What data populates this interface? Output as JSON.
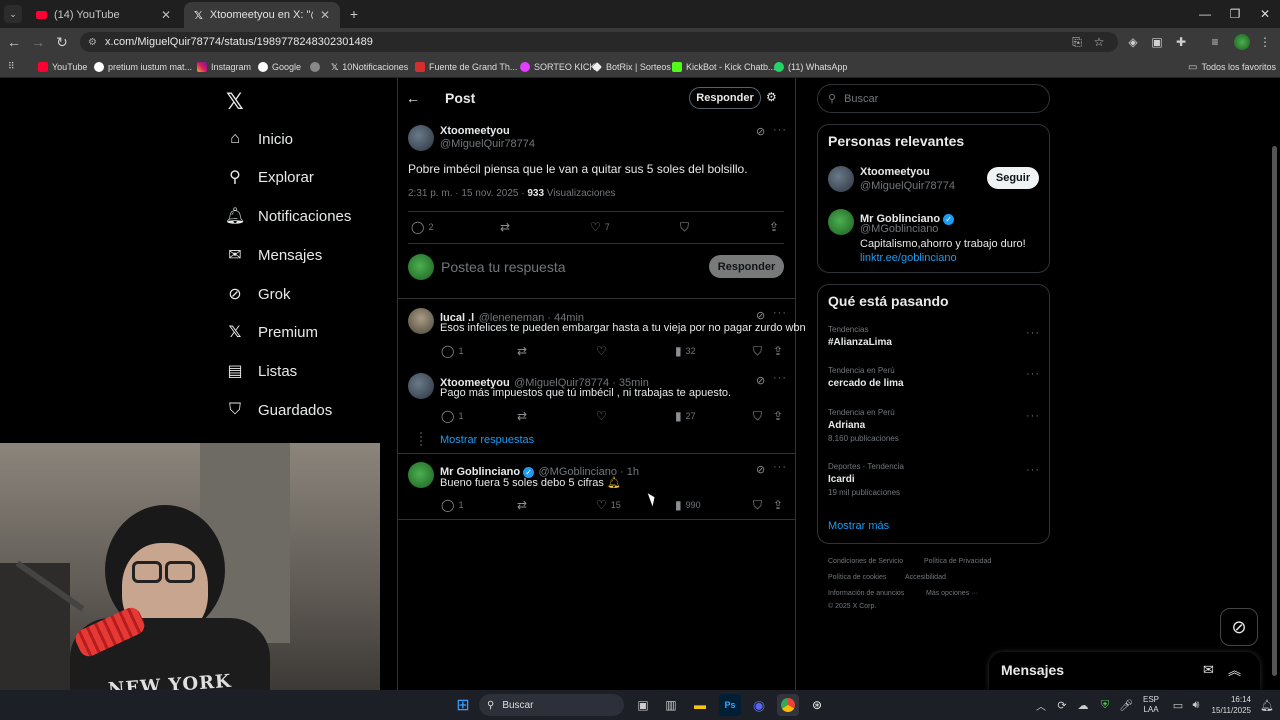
{
  "browser": {
    "tabs": [
      {
        "title": "(14) YouTube",
        "active": false
      },
      {
        "title": "Xtoomeetyou en X: \"@MGoblin",
        "active": true
      }
    ],
    "new_tab": "+",
    "url": "x.com/MiguelQuir78774/status/1989778248302301489",
    "bookmarks": [
      "YouTube",
      "pretium iustum mat...",
      "Instagram",
      "Google",
      "",
      "10Notificaciones",
      "Fuente de Grand Th...",
      "SORTEO KICK",
      "BotRix | Sorteos",
      "KickBot - Kick Chatb...",
      "(11) WhatsApp"
    ],
    "all_bookmarks": "Todos los favoritos"
  },
  "nav": {
    "items": [
      "Inicio",
      "Explorar",
      "Notificaciones",
      "Mensajes",
      "Grok",
      "Premium",
      "Listas",
      "Guardados"
    ]
  },
  "post": {
    "header_title": "Post",
    "reply_btn": "Responder",
    "author_name": "Xtoomeetyou",
    "author_handle": "@MiguelQuir78774",
    "text": "Pobre imbécil piensa que le van a quitar sus 5 soles del bolsillo.",
    "timestamp": "2:31 p. m. · 15 nov. 2025 · ",
    "views": "933",
    "views_label": " Visualizaciones",
    "replies": "2",
    "likes": "7",
    "compose_placeholder": "Postea tu respuesta",
    "compose_btn": "Responder"
  },
  "replies": [
    {
      "name": "lucal .l",
      "handle": "@leneneman · 44min",
      "text": "Esos infelices te pueden embargar hasta a tu vieja por no pagar zurdo wbn",
      "replies": "1",
      "likes": "",
      "views": "32"
    },
    {
      "name": "Xtoomeetyou",
      "handle": "@MiguelQuir78774 · 35min",
      "text": "Pago más impuestos que tú imbécil , ni trabajas te apuesto.",
      "replies": "1",
      "likes": "",
      "views": "27"
    },
    {
      "name": "Mr Goblinciano",
      "handle": "@MGoblinciano · 1h",
      "text": "Bueno fuera 5 soles debo 5 cifras",
      "replies": "1",
      "likes": "15",
      "views": "990"
    }
  ],
  "show_replies": "Mostrar respuestas",
  "search_placeholder": "Buscar",
  "relevant": {
    "title": "Personas relevantes",
    "people": [
      {
        "name": "Xtoomeetyou",
        "handle": "@MiguelQuir78774",
        "btn": "Seguir"
      },
      {
        "name": "Mr Goblinciano",
        "handle": "@MGoblinciano",
        "bio": "Capitalismo,ahorro y trabajo duro!",
        "link": "linktr.ee/goblinciano"
      }
    ]
  },
  "trending": {
    "title": "Qué está pasando",
    "items": [
      {
        "cat": "Tendencias",
        "name": "#AlianzaLima",
        "count": ""
      },
      {
        "cat": "Tendencia en Perú",
        "name": "cercado de lima",
        "count": ""
      },
      {
        "cat": "Tendencia en Perú",
        "name": "Adriana",
        "count": "8.160 publicaciones"
      },
      {
        "cat": "Deportes · Tendencia",
        "name": "Icardi",
        "count": "19 mil publicaciones"
      }
    ],
    "more": "Mostrar más"
  },
  "footer": {
    "links": [
      "Condiciones de Servicio",
      "Política de Privacidad",
      "Política de cookies",
      "Accesibilidad",
      "Información de anuncios",
      "Más opciones ···"
    ],
    "copyright": "© 2025 X Corp."
  },
  "messages_drawer": "Mensajes",
  "taskbar": {
    "search": "Buscar",
    "lang": "ESP",
    "lang2": "LAA",
    "time": "16:14",
    "date": "15/11/2025"
  }
}
